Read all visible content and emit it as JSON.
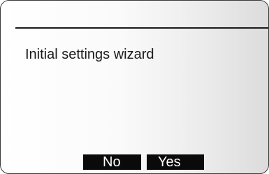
{
  "screen": {
    "title": "Initial settings wizard"
  },
  "softkeys": {
    "no_label": "No",
    "yes_label": "Yes"
  }
}
